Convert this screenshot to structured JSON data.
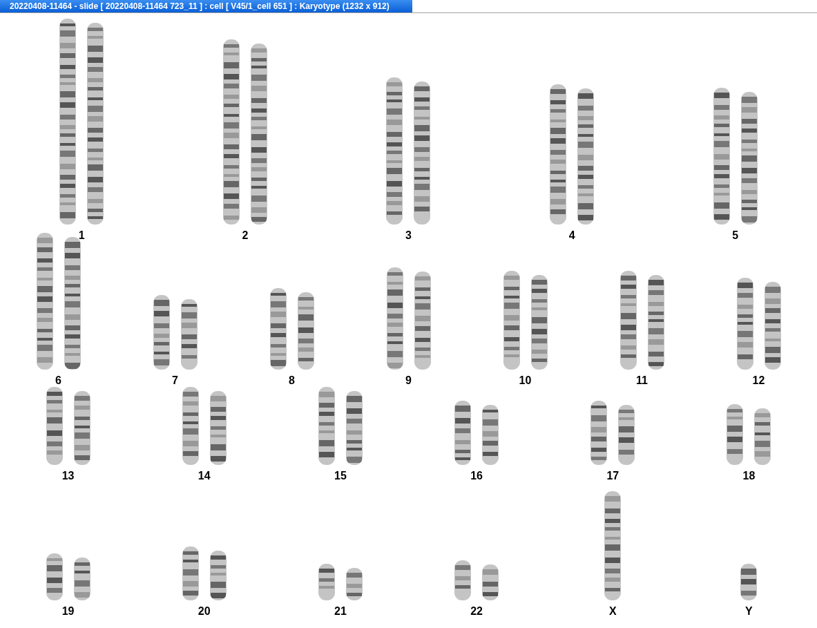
{
  "window": {
    "title": "20220408-11464 - slide [ 20220408-11464 723_11 ] : cell [ V45/1_cell 651 ] : Karyotype  (1232 x 912)"
  },
  "karyotype": {
    "rows": [
      {
        "groups": [
          {
            "label": "1",
            "kind": "pair"
          },
          {
            "label": "2",
            "kind": "pair"
          },
          {
            "label": "3",
            "kind": "pair"
          },
          {
            "label": "4",
            "kind": "pair"
          },
          {
            "label": "5",
            "kind": "pair"
          }
        ]
      },
      {
        "groups": [
          {
            "label": "6",
            "kind": "pair"
          },
          {
            "label": "7",
            "kind": "pair"
          },
          {
            "label": "8",
            "kind": "pair"
          },
          {
            "label": "9",
            "kind": "pair"
          },
          {
            "label": "10",
            "kind": "pair"
          },
          {
            "label": "11",
            "kind": "pair"
          },
          {
            "label": "12",
            "kind": "pair"
          }
        ]
      },
      {
        "groups": [
          {
            "label": "13",
            "kind": "pair"
          },
          {
            "label": "14",
            "kind": "pair"
          },
          {
            "label": "15",
            "kind": "pair"
          },
          {
            "label": "16",
            "kind": "pair"
          },
          {
            "label": "17",
            "kind": "pair"
          },
          {
            "label": "18",
            "kind": "pair"
          }
        ]
      },
      {
        "groups": [
          {
            "label": "19",
            "kind": "pair"
          },
          {
            "label": "20",
            "kind": "pair"
          },
          {
            "label": "21",
            "kind": "pair"
          },
          {
            "label": "22",
            "kind": "pair"
          },
          {
            "label": "X",
            "kind": "single"
          },
          {
            "label": "Y",
            "kind": "single"
          }
        ]
      }
    ]
  }
}
